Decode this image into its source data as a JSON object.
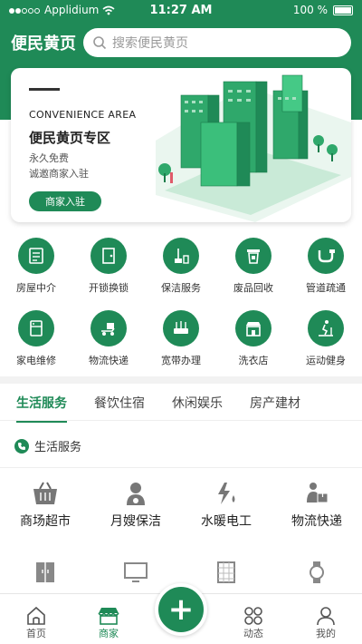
{
  "status_bar": {
    "carrier": "Applidium",
    "time": "11:27 AM",
    "battery": "100 %"
  },
  "header": {
    "title": "便民黄页",
    "search_placeholder": "搜索便民黄页"
  },
  "banner": {
    "en_title": "CONVENIENCE AREA",
    "cn_title": "便民黄页专区",
    "line1": "永久免费",
    "line2": "诚邀商家入驻",
    "button": "商家入驻"
  },
  "services_row1": [
    {
      "label": "房屋中介",
      "icon": "house-agency-icon"
    },
    {
      "label": "开锁换锁",
      "icon": "door-lock-icon"
    },
    {
      "label": "保洁服务",
      "icon": "cleaning-icon"
    },
    {
      "label": "废品回收",
      "icon": "recycle-bin-icon"
    },
    {
      "label": "管道疏通",
      "icon": "pipe-icon"
    }
  ],
  "services_row2": [
    {
      "label": "家电维修",
      "icon": "appliance-repair-icon"
    },
    {
      "label": "物流快递",
      "icon": "delivery-icon"
    },
    {
      "label": "宽带办理",
      "icon": "router-icon"
    },
    {
      "label": "洗衣店",
      "icon": "laundry-shop-icon"
    },
    {
      "label": "运动健身",
      "icon": "treadmill-icon"
    }
  ],
  "tabs": [
    "生活服务",
    "餐饮住宿",
    "休闲娱乐",
    "房产建材"
  ],
  "section": {
    "title": "生活服务"
  },
  "categories": [
    {
      "label": "商场超市",
      "icon": "basket-icon"
    },
    {
      "label": "月嫂保洁",
      "icon": "nanny-icon"
    },
    {
      "label": "水暖电工",
      "icon": "electric-icon"
    },
    {
      "label": "物流快递",
      "icon": "courier-icon"
    }
  ],
  "categories_row2_icons": [
    "wardrobe-icon",
    "monitor-icon",
    "tile-icon",
    "watch-icon"
  ],
  "tabbar": [
    {
      "label": "首页",
      "icon": "home-icon"
    },
    {
      "label": "商家",
      "icon": "shop-icon"
    },
    {
      "label": "动态",
      "icon": "feed-icon"
    },
    {
      "label": "我的",
      "icon": "profile-icon"
    }
  ],
  "colors": {
    "accent": "#1f8a57",
    "background": "#ffffff"
  }
}
